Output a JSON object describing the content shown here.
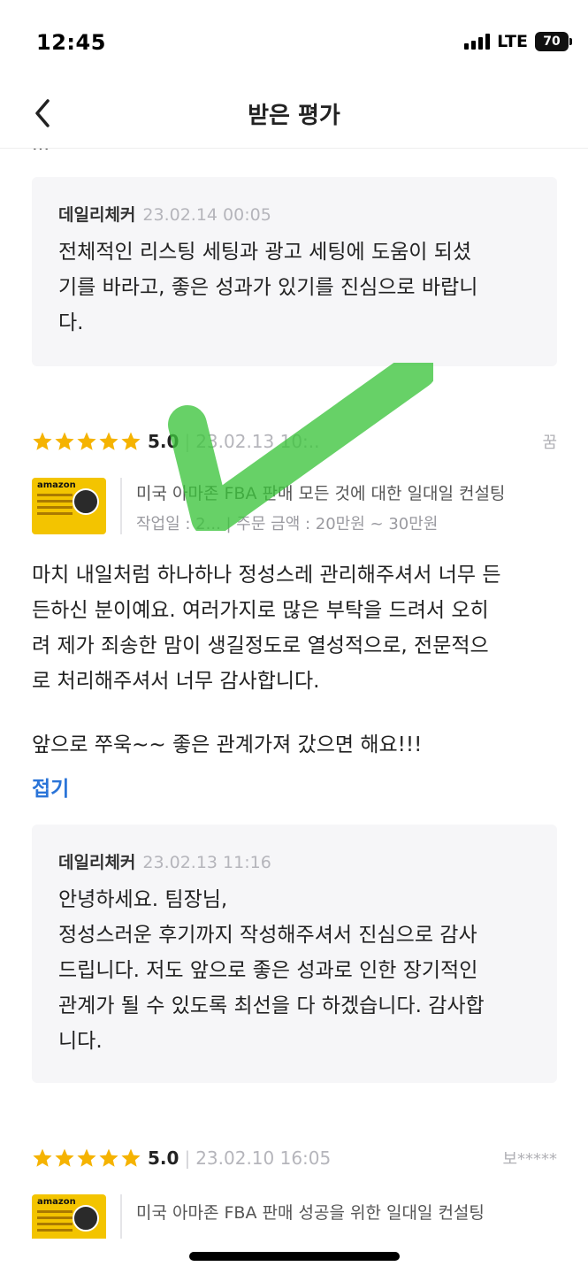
{
  "status": {
    "time": "12:45",
    "network": "LTE",
    "battery": "70"
  },
  "nav": {
    "title": "받은 평가"
  },
  "top_cut_text": "...",
  "replies": [
    {
      "author": "데일리체커",
      "date": "23.02.14 00:05",
      "lines": [
        "전체적인 리스팅 세팅과 광고 세팅에 도움이 되셨",
        "기를 바라고, 좋은 성과가 있기를 진심으로 바랍니",
        "다."
      ]
    },
    {
      "author": "데일리체커",
      "date": "23.02.13 11:16",
      "lines": [
        "안녕하세요. 팀장님,",
        "정성스러운 후기까지 작성해주셔서 진심으로 감사",
        "드립니다. 저도 앞으로 좋은 성과로 인한 장기적인",
        "관계가 될 수 있도록 최선을 다 하겠습니다. 감사합",
        "니다."
      ]
    }
  ],
  "reviews": [
    {
      "rating": 5,
      "score": "5.0",
      "date": "23.02.13 10:..",
      "reviewer": "꿈",
      "service_title": "미국 아마존 FBA 판매 모든 것에 대한 일대일 컨설팅",
      "service_meta": "작업일 : 2... | 주문 금액 : 20만원 ~ 30만원",
      "thumb_brand": "amazon",
      "body_lines": [
        "마치 내일처럼 하나하나 정성스레 관리해주셔서 너무 든",
        "든하신 분이예요. 여러가지로 많은 부탁을 드려서 오히",
        "려 제가 죄송한 맘이 생길정도로 열성적으로, 전문적으",
        "로 처리해주셔서 너무 감사합니다.",
        "",
        "앞으로 쭈욱~~ 좋은 관계가져 갔으면 해요!!!"
      ],
      "fold_label": "접기"
    },
    {
      "rating": 5,
      "score": "5.0",
      "date": "23.02.10 16:05",
      "reviewer": "보*****",
      "service_title": "미국 아마존 FBA 판매 성공을 위한 일대일 컨설팅",
      "thumb_brand": "amazon"
    }
  ],
  "colors": {
    "star": "#f5b301",
    "link": "#2a74d8",
    "checkmark": "#3cc43c",
    "reply_bg": "#f6f6f8"
  },
  "icons": {
    "back": "chevron-left-icon",
    "star": "star-icon",
    "overlay": "checkmark-icon"
  }
}
